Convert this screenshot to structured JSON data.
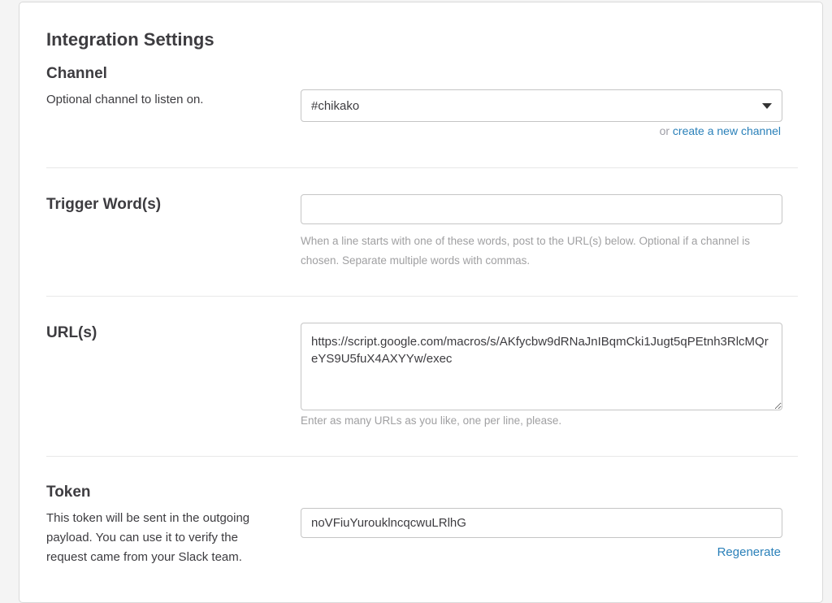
{
  "page": {
    "title": "Integration Settings"
  },
  "channel": {
    "heading": "Channel",
    "description": "Optional channel to listen on.",
    "selected_value": "#chikako",
    "or_text": "or",
    "create_link": "create a new channel"
  },
  "trigger": {
    "heading": "Trigger Word(s)",
    "value": "",
    "hint": "When a line starts with one of these words, post to the URL(s) below. Optional if a channel is chosen. Separate multiple words with commas."
  },
  "urls": {
    "heading": "URL(s)",
    "value": "https://script.google.com/macros/s/AKfycbw9dRNaJnIBqmCki1Jugt5qPEtnh3RlcMQreYS9U5fuX4AXYYw/exec",
    "hint": "Enter as many URLs as you like, one per line, please."
  },
  "token": {
    "heading": "Token",
    "description": "This token will be sent in the outgoing payload. You can use it to verify the request came from your Slack team.",
    "value": "noVFiuYurouklncqcwuLRlhG",
    "regenerate_label": "Regenerate"
  },
  "colors": {
    "link": "#2a80b9",
    "hint_text": "#a0a0a2",
    "text": "#3d3c40"
  }
}
